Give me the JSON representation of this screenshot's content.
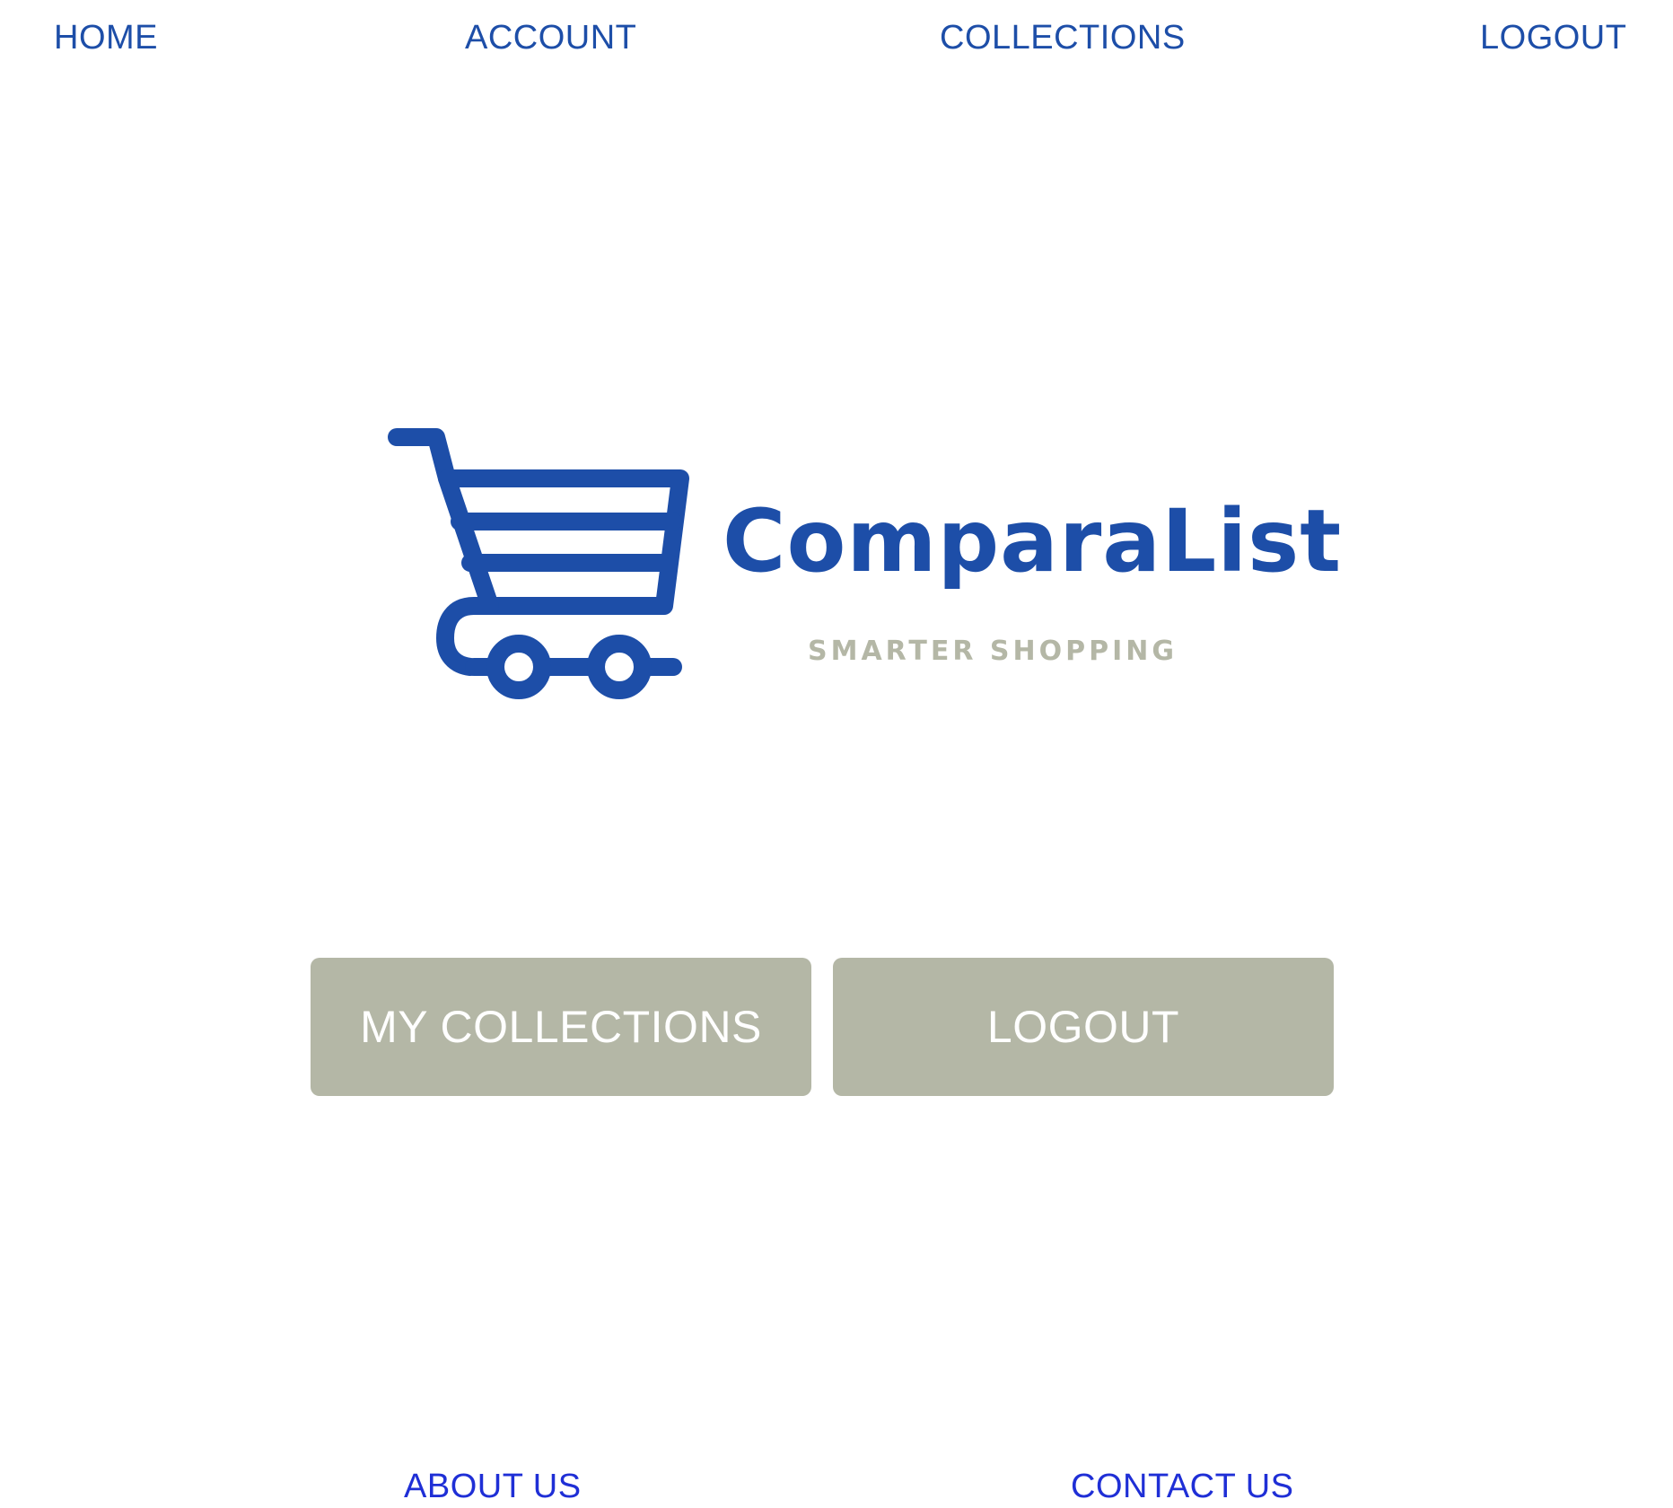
{
  "nav": {
    "home": "HOME",
    "account": "ACCOUNT",
    "collections": "COLLECTIONS",
    "logout": "LOGOUT"
  },
  "logo": {
    "icon": "shopping-cart-icon",
    "name": "ComparaList",
    "tagline": "SMARTER SHOPPING"
  },
  "actions": {
    "my_collections": "MY COLLECTIONS",
    "logout": "LOGOUT"
  },
  "footer": {
    "about": "ABOUT US",
    "contact": "CONTACT US"
  },
  "colors": {
    "nav_link": "#1d4ea8",
    "brand_blue": "#1d4ea8",
    "tagline": "#b4b7a6",
    "button_bg": "#b4b7a6",
    "button_text": "#ffffff",
    "footer_link": "#1f2fd6",
    "background": "#ffffff"
  }
}
